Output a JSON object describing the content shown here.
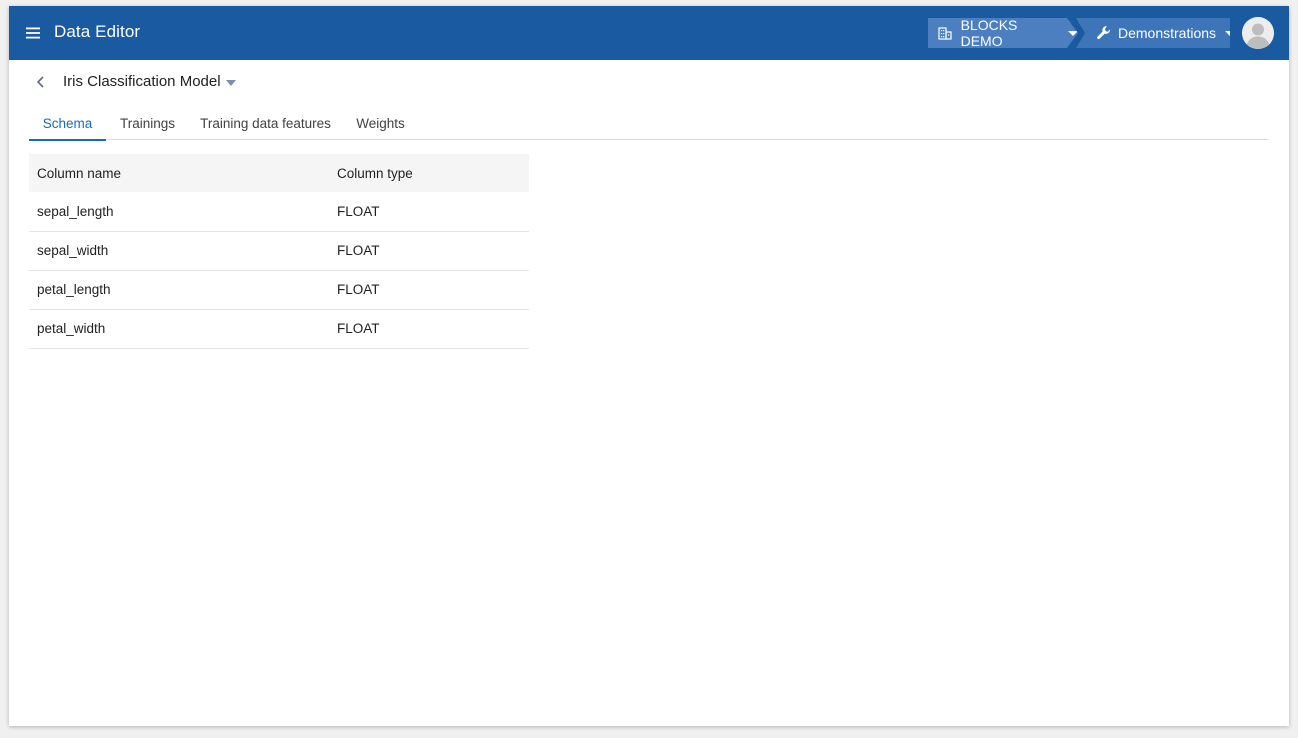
{
  "app": {
    "title": "Data Editor"
  },
  "header": {
    "org_label": "BLOCKS DEMO",
    "project_label": "Demonstrations"
  },
  "breadcrumb": {
    "model_name": "Iris Classification Model"
  },
  "tabs": [
    {
      "label": "Schema",
      "active": true
    },
    {
      "label": "Trainings",
      "active": false
    },
    {
      "label": "Training data features",
      "active": false
    },
    {
      "label": "Weights",
      "active": false
    }
  ],
  "schema": {
    "headers": {
      "name": "Column name",
      "type": "Column type"
    },
    "rows": [
      {
        "name": "sepal_length",
        "type": "FLOAT"
      },
      {
        "name": "sepal_width",
        "type": "FLOAT"
      },
      {
        "name": "petal_length",
        "type": "FLOAT"
      },
      {
        "name": "petal_width",
        "type": "FLOAT"
      }
    ]
  },
  "colors": {
    "appbar": "#1a5aa0",
    "accent": "#1a6ab8"
  },
  "icons": {
    "menu": "menu-icon",
    "org": "building-icon",
    "project": "wrench-icon",
    "back": "chevron-left-icon",
    "avatar": "user-avatar-icon"
  }
}
